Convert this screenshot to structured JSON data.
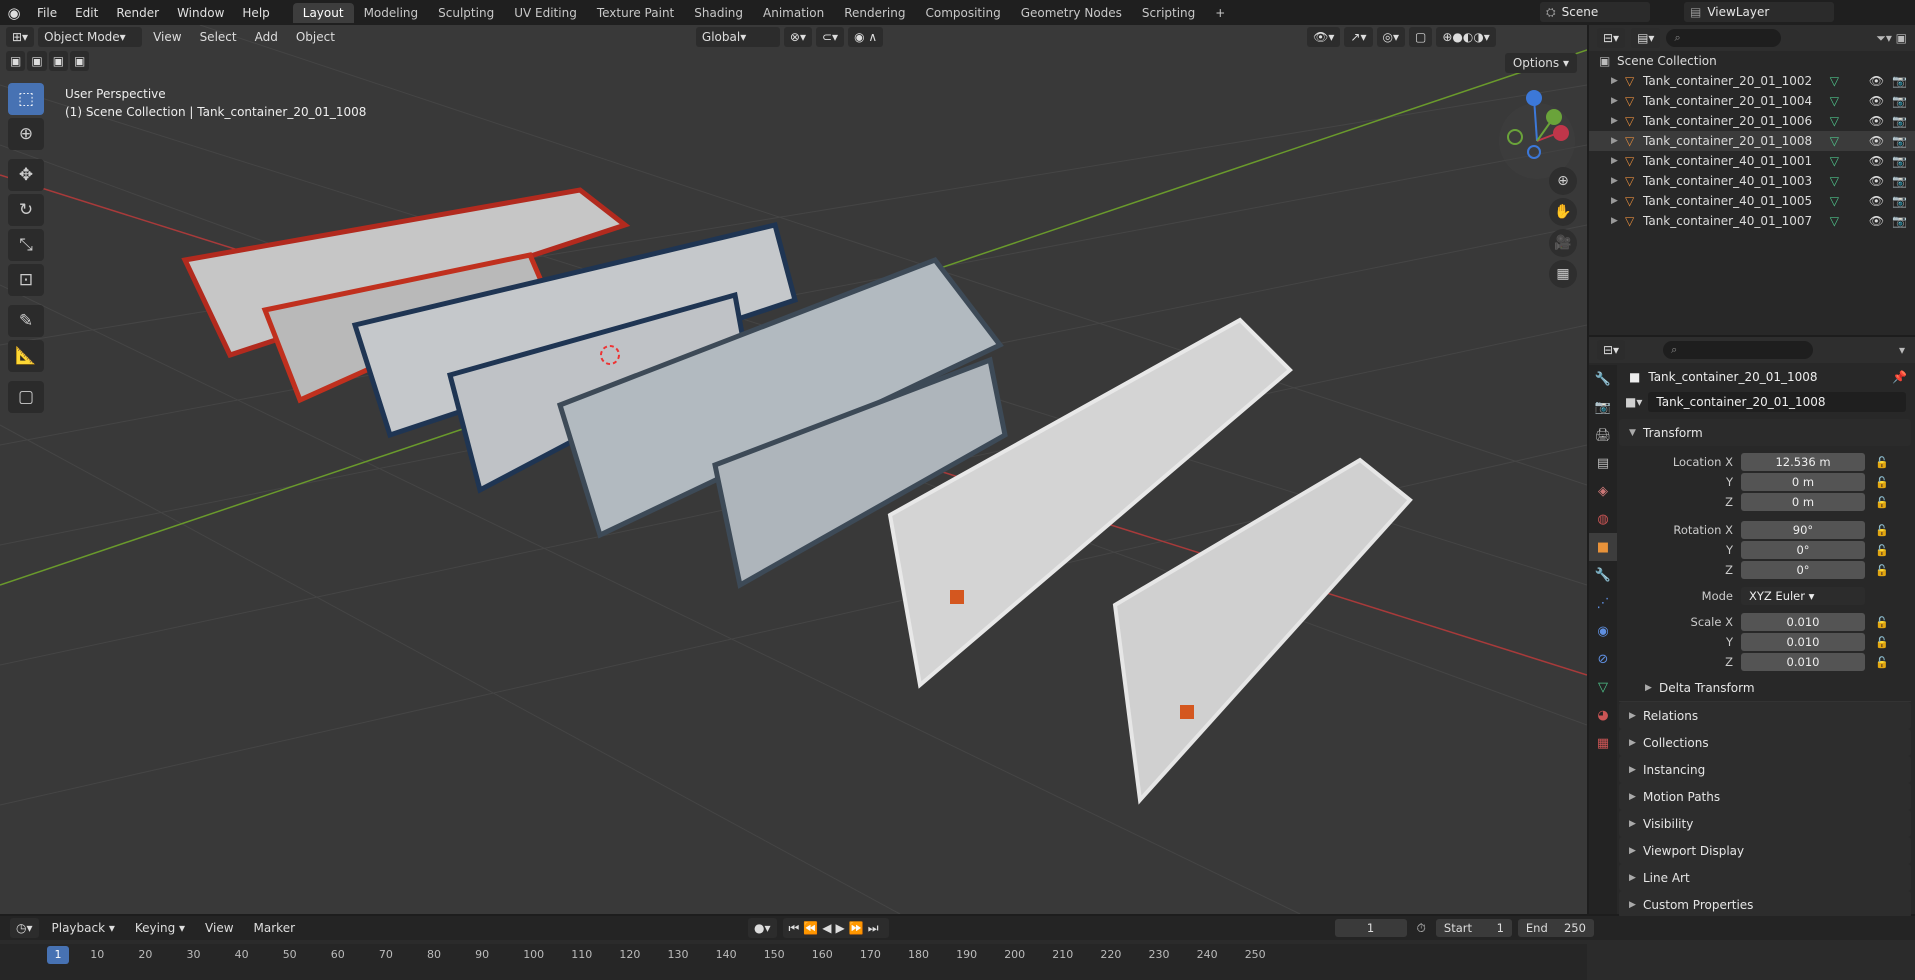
{
  "menu": [
    "File",
    "Edit",
    "Render",
    "Window",
    "Help"
  ],
  "workspaces": [
    "Layout",
    "Modeling",
    "Sculpting",
    "UV Editing",
    "Texture Paint",
    "Shading",
    "Animation",
    "Rendering",
    "Compositing",
    "Geometry Nodes",
    "Scripting"
  ],
  "scene_name": "Scene",
  "view_layer": "ViewLayer",
  "viewport": {
    "mode": "Object Mode",
    "menus": [
      "View",
      "Select",
      "Add",
      "Object"
    ],
    "orientation": "Global",
    "options": "Options",
    "overlay_line1": "User Perspective",
    "overlay_line2": "(1) Scene Collection | Tank_container_20_01_1008"
  },
  "outliner": {
    "root": "Scene Collection",
    "items": [
      "Tank_container_20_01_1002",
      "Tank_container_20_01_1004",
      "Tank_container_20_01_1006",
      "Tank_container_20_01_1008",
      "Tank_container_40_01_1001",
      "Tank_container_40_01_1003",
      "Tank_container_40_01_1005",
      "Tank_container_40_01_1007"
    ]
  },
  "props": {
    "object": "Tank_container_20_01_1008",
    "name": "Tank_container_20_01_1008",
    "transform": "Transform",
    "loc_label": "Location X",
    "loc": [
      "12.536 m",
      "0 m",
      "0 m"
    ],
    "rot_label": "Rotation X",
    "rot": [
      "90°",
      "0°",
      "0°"
    ],
    "mode_label": "Mode",
    "mode": "XYZ Euler",
    "scale_label": "Scale X",
    "scale": [
      "0.010",
      "0.010",
      "0.010"
    ],
    "y": "Y",
    "z": "Z",
    "delta": "Delta Transform",
    "sections": [
      "Relations",
      "Collections",
      "Instancing",
      "Motion Paths",
      "Visibility",
      "Viewport Display",
      "Line Art",
      "Custom Properties"
    ]
  },
  "timeline": {
    "menus": [
      "Playback",
      "Keying",
      "View",
      "Marker"
    ],
    "frame": "1",
    "start_label": "Start",
    "start": "1",
    "end_label": "End",
    "end": "250",
    "ticks": [
      "1",
      "10",
      "20",
      "30",
      "40",
      "50",
      "60",
      "70",
      "80",
      "90",
      "100",
      "110",
      "120",
      "130",
      "140",
      "150",
      "160",
      "170",
      "180",
      "190",
      "200",
      "210",
      "220",
      "230",
      "240",
      "250"
    ]
  }
}
